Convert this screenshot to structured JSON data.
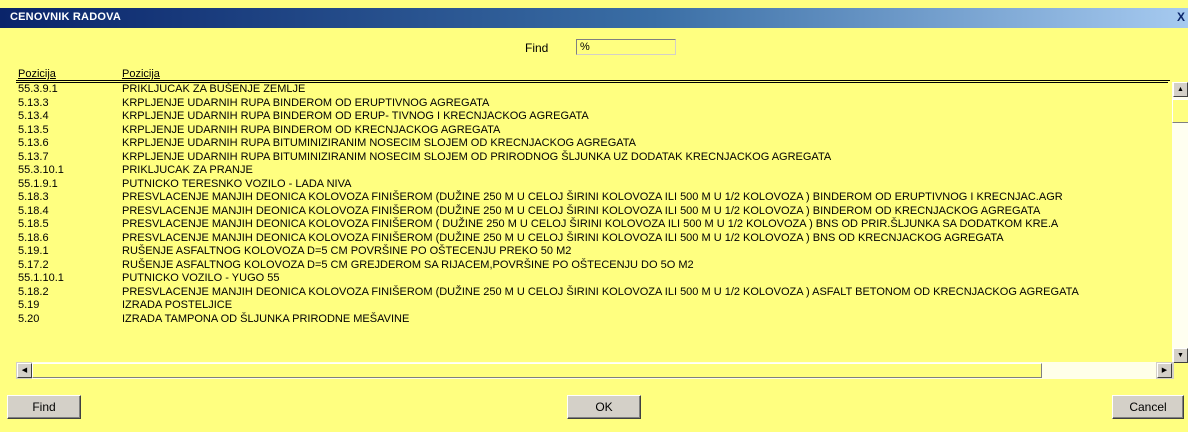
{
  "window": {
    "title": "CENOVNIK RADOVA",
    "close_glyph": "X"
  },
  "search": {
    "label": "Find",
    "value": "%"
  },
  "grid": {
    "columns": [
      "Pozicija",
      "Pozicija"
    ],
    "rows": [
      {
        "code": "55.3.9.1",
        "desc": "PRIKLJUCAK ZA BUŠENJE ZEMLJE"
      },
      {
        "code": "5.13.3",
        "desc": "KRPLJENJE UDARNIH RUPA BINDEROM OD ERUPTIVNOG AGREGATA"
      },
      {
        "code": "5.13.4",
        "desc": "KRPLJENJE UDARNIH RUPA BINDEROM OD ERUP- TIVNOG I KRECNJACKOG AGREGATA"
      },
      {
        "code": "5.13.5",
        "desc": "KRPLJENJE UDARNIH RUPA BINDEROM OD KRECNJACKOG AGREGATA"
      },
      {
        "code": "5.13.6",
        "desc": "KRPLJENJE UDARNIH RUPA BITUMINIZIRANIM NOSECIM SLOJEM OD KRECNJACKOG AGREGATA"
      },
      {
        "code": "5.13.7",
        "desc": "KRPLJENJE UDARNIH RUPA BITUMINIZIRANIM NOSECIM SLOJEM OD PRIRODNOG ŠLJUNKA UZ DODATAK KRECNJACKOG AGREGATA"
      },
      {
        "code": "55.3.10.1",
        "desc": "PRIKLJUCAK ZA PRANJE"
      },
      {
        "code": "55.1.9.1",
        "desc": "PUTNICKO TERESNKO VOZILO - LADA NIVA"
      },
      {
        "code": "5.18.3",
        "desc": "PRESVLACENJE MANJIH DEONICA KOLOVOZA FINIŠEROM (DUŽINE 250 M U CELOJ ŠIRINI KOLOVOZA ILI 500 M U 1/2 KOLOVOZA ) BINDEROM OD ERUPTIVNOG I KRECNJAC.AGR"
      },
      {
        "code": "5.18.4",
        "desc": "PRESVLACENJE MANJIH DEONICA KOLOVOZA FINIŠEROM (DUŽINE 250 M U CELOJ ŠIRINI KOLOVOZA ILI 500 M U 1/2 KOLOVOZA ) BINDEROM OD KRECNJACKOG AGREGATA"
      },
      {
        "code": "5.18.5",
        "desc": "PRESVLACENJE MANJIH DEONICA KOLOVOZA FINIŠEROM ( DUŽINE 250 M U CELOJ ŠIRINI KOLOVOZA ILI 500 M U 1/2 KOLOVOZA ) BNS OD PRIR.ŠLJUNKA SA DODATKOM KRE.A"
      },
      {
        "code": "5.18.6",
        "desc": "PRESVLACENJE MANJIH DEONICA KOLOVOZA FINIŠEROM (DUŽINE 250 M U CELOJ ŠIRINI KOLOVOZA ILI 500 M U 1/2 KOLOVOZA ) BNS OD KRECNJACKOG AGREGATA"
      },
      {
        "code": "5.19.1",
        "desc": "RUŠENJE ASFALTNOG KOLOVOZA D=5 CM POVRŠINE PO OŠTECENJU PREKO 50 M2"
      },
      {
        "code": "5.17.2",
        "desc": "RUŠENJE ASFALTNOG KOLOVOZA D=5 CM GREJDEROM SA RIJACEM,POVRŠINE PO OŠTECENJU DO 5O M2"
      },
      {
        "code": "55.1.10.1",
        "desc": "PUTNICKO VOZILO - YUGO 55"
      },
      {
        "code": "5.18.2",
        "desc": "PRESVLACENJE MANJIH DEONICA KOLOVOZA FINIŠEROM (DUŽINE 250 M U CELOJ ŠIRINI KOLOVOZA ILI 500 M U 1/2 KOLOVOZA ) ASFALT BETONOM OD KRECNJACKOG AGREGATA"
      },
      {
        "code": "5.19",
        "desc": "IZRADA POSTELJICE"
      },
      {
        "code": "5.20",
        "desc": "IZRADA TAMPONA OD ŠLJUNKA PRIRODNE MEŠAVINE"
      }
    ]
  },
  "buttons": {
    "find": "Find",
    "ok": "OK",
    "cancel": "Cancel"
  },
  "icons": {
    "scroll_up": "arrow-up-icon",
    "scroll_down": "arrow-down-icon",
    "scroll_left": "arrow-left-icon",
    "scroll_right": "arrow-right-icon"
  },
  "colors": {
    "background": "#ffff80",
    "titlebar": "#0a246a"
  }
}
